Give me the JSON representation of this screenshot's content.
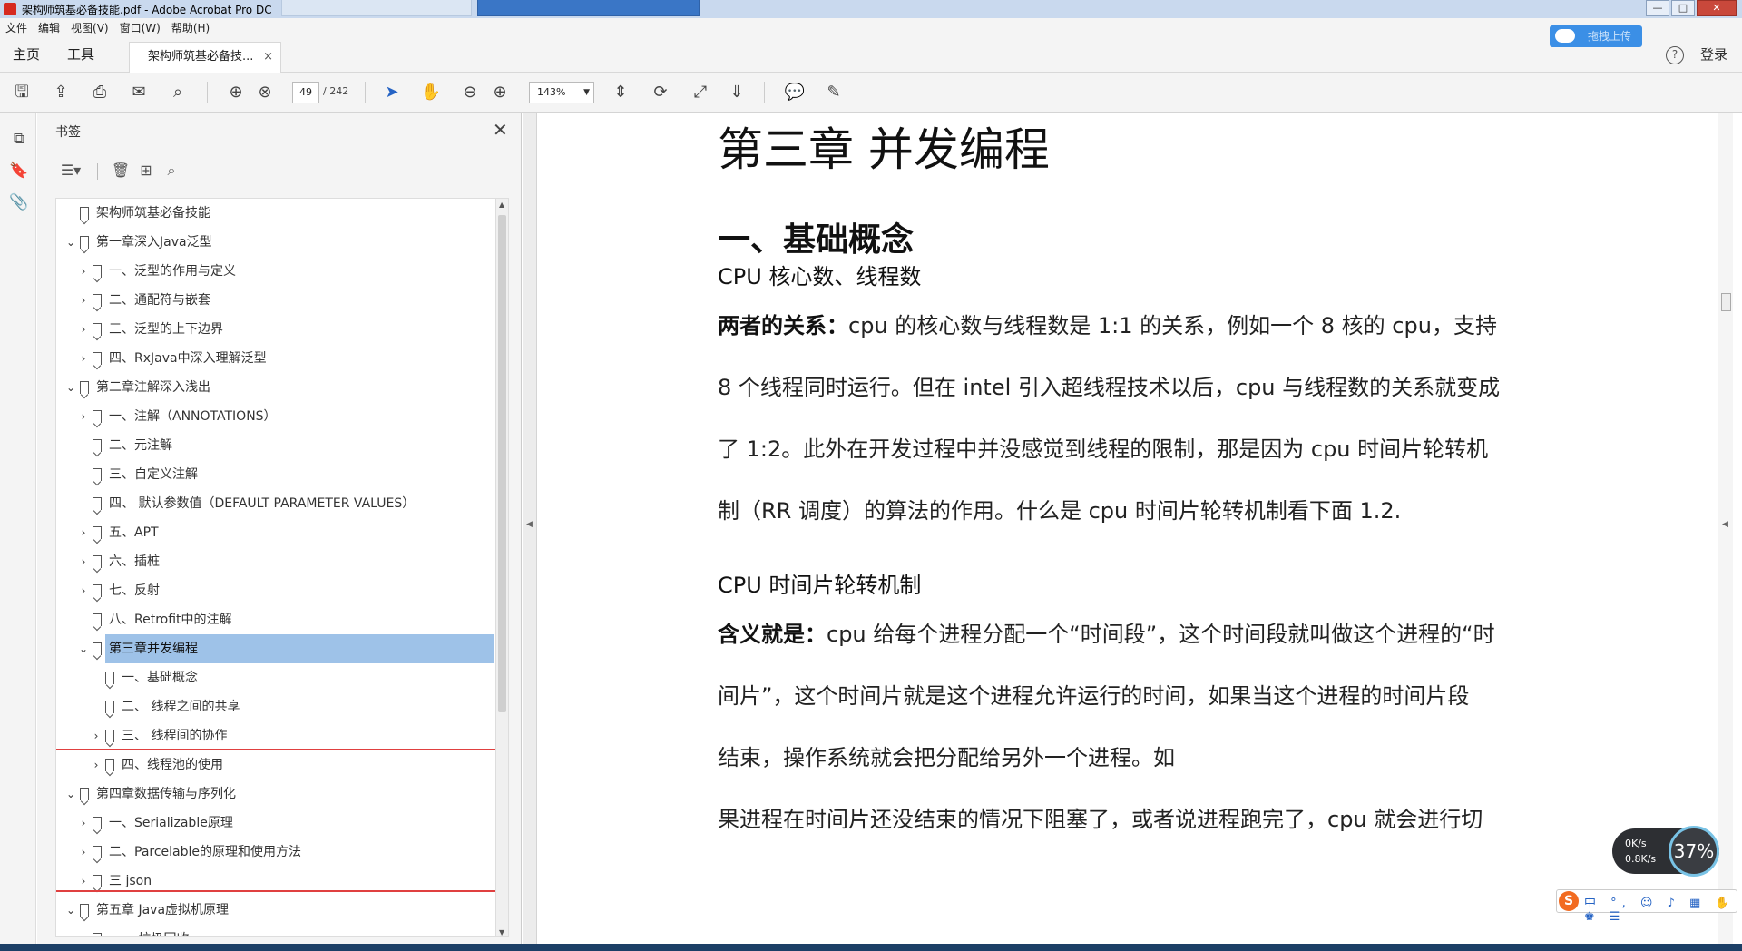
{
  "window": {
    "title": "架构师筑基必备技能.pdf - Adobe Acrobat Pro DC",
    "controls": {
      "minimize": "—",
      "maximize": "□",
      "close": "✕"
    }
  },
  "menu": [
    "文件",
    "编辑",
    "视图(V)",
    "窗口(W)",
    "帮助(H)"
  ],
  "nav": {
    "home": "主页",
    "tools": "工具",
    "doc_tab": "架构师筑基必备技...",
    "doc_tab_close": "×"
  },
  "baidu": {
    "label": "拖拽上传"
  },
  "account": {
    "help": "?",
    "login": "登录"
  },
  "toolbar": {
    "page_current": "49",
    "page_total": "/ 242",
    "zoom": "143%"
  },
  "bookmarks": {
    "title": "书签",
    "close": "✕",
    "items": [
      {
        "label": "架构师筑基必备技能",
        "level": 0,
        "chevron": ""
      },
      {
        "label": "第一章深入Java泛型",
        "level": 0,
        "chevron": "down"
      },
      {
        "label": "一、泛型的作用与定义",
        "level": 1,
        "chevron": "right"
      },
      {
        "label": "二、通配符与嵌套",
        "level": 1,
        "chevron": "right"
      },
      {
        "label": "三、泛型的上下边界",
        "level": 1,
        "chevron": "right"
      },
      {
        "label": "四、RxJava中深入理解泛型",
        "level": 1,
        "chevron": "right"
      },
      {
        "label": "第二章注解深入浅出",
        "level": 0,
        "chevron": "down"
      },
      {
        "label": "一、注解（ANNOTATIONS）",
        "level": 1,
        "chevron": "right"
      },
      {
        "label": "二、元注解",
        "level": 1,
        "chevron": ""
      },
      {
        "label": "三、自定义注解",
        "level": 1,
        "chevron": ""
      },
      {
        "label": "四、 默认参数值（DEFAULT PARAMETER VALUES）",
        "level": 1,
        "chevron": ""
      },
      {
        "label": "五、APT",
        "level": 1,
        "chevron": "right"
      },
      {
        "label": "六、插桩",
        "level": 1,
        "chevron": "right"
      },
      {
        "label": "七、反射",
        "level": 1,
        "chevron": "right"
      },
      {
        "label": "八、Retrofit中的注解",
        "level": 1,
        "chevron": ""
      },
      {
        "label": "第三章并发编程",
        "level": 1,
        "chevron": "down",
        "selected": true
      },
      {
        "label": "一、基础概念",
        "level": 2,
        "chevron": ""
      },
      {
        "label": "二、 线程之间的共享",
        "level": 2,
        "chevron": ""
      },
      {
        "label": "三、 线程间的协作",
        "level": 2,
        "chevron": "right"
      },
      {
        "label": "四、线程池的使用",
        "level": 2,
        "chevron": "right"
      },
      {
        "label": "第四章数据传输与序列化",
        "level": 0,
        "chevron": "down"
      },
      {
        "label": "一、Serializable原理",
        "level": 1,
        "chevron": "right"
      },
      {
        "label": "二、Parcelable的原理和使用方法",
        "level": 1,
        "chevron": "right"
      },
      {
        "label": "三 json",
        "level": 1,
        "chevron": "right"
      },
      {
        "label": "第五章 Java虚拟机原理",
        "level": 0,
        "chevron": "down"
      },
      {
        "label": "一、 垃圾回收",
        "level": 1,
        "chevron": "right"
      }
    ]
  },
  "document": {
    "chapter": "第三章  并发编程",
    "section": "一、基础概念",
    "sub1": "CPU 核心数、线程数",
    "p1_bold": "两者的关系：",
    "p1_lines": [
      "cpu 的核心数与线程数是 1:1 的关系，例如一个 8 核的 cpu，支持",
      "8 个线程同时运行。但在 intel 引入超线程技术以后，cpu 与线程数的关系就变成",
      "了 1:2。此外在开发过程中并没感觉到线程的限制，那是因为 cpu 时间片轮转机",
      "制（RR 调度）的算法的作用。什么是 cpu 时间片轮转机制看下面 1.2."
    ],
    "sub2": "CPU 时间片轮转机制",
    "p2_bold": "含义就是：",
    "p2_lines": [
      "cpu 给每个进程分配一个“时间段”，这个时间段就叫做这个进程的“时",
      "间片”，这个时间片就是这个进程允许运行的时间，如果当这个进程的时间片段",
      "结束，操作系统就会把分配给另外一个进程。如",
      "果进程在时间片还没结束的情况下阻塞了，或者说进程跑完了，cpu 就会进行切"
    ]
  },
  "netmeter": {
    "up": "0K/s",
    "down": "0.8K/s",
    "percent": "37%"
  },
  "ime": {
    "logo": "S",
    "text": "中 °, ☺ ♪ ▦ ✋ ♚ ☰"
  }
}
